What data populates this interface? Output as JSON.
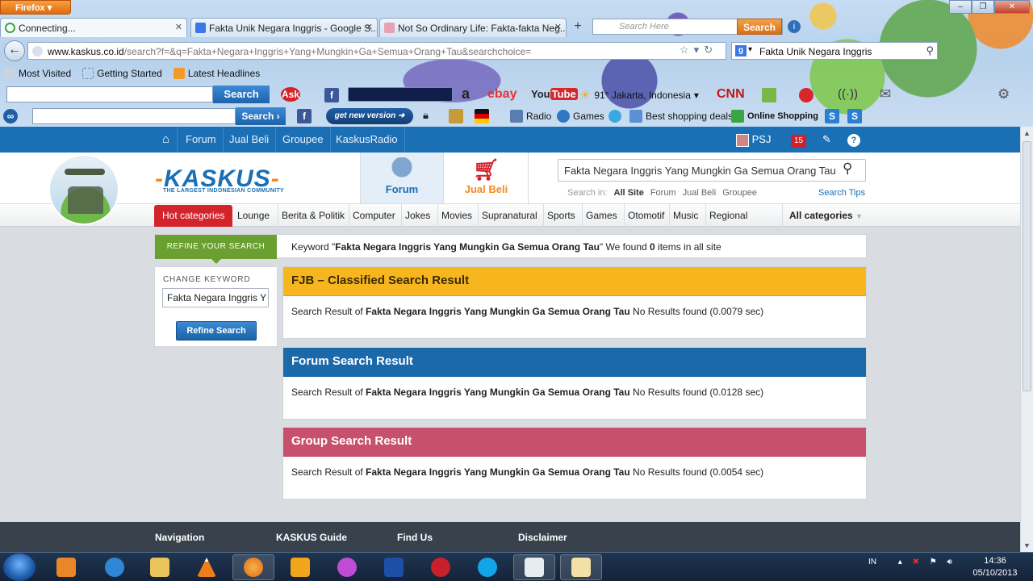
{
  "browser": {
    "firefox_button": "Firefox",
    "tabs": [
      {
        "title": "Connecting..."
      },
      {
        "title": "Fakta Unik Negara Inggris - Google S..."
      },
      {
        "title": "Not So Ordinary Life: Fakta-fakta Neg..."
      }
    ],
    "toolbar_search_placeholder": "Search Here",
    "toolbar_search_button": "Search",
    "url_domain": "www.kaskus.co.id",
    "url_rest": "/search?f=&q=Fakta+Negara+Inggris+Yang+Mungkin+Ga+Semua+Orang+Tau&searchchoice=",
    "web_search_value": "Fakta Unik Negara Inggris",
    "bookmarks": [
      {
        "label": "Most Visited"
      },
      {
        "label": "Getting Started"
      },
      {
        "label": "Latest Headlines"
      }
    ],
    "ask_search_button": "Search",
    "weather": "91° Jakarta, Indonesia",
    "toolbar2_search_button": "Search",
    "get_new_version": "get new version",
    "radio": "Radio",
    "games": "Games",
    "best_shopping": "Best shopping deals",
    "online_shopping": "Online Shopping"
  },
  "kaskus": {
    "topnav": [
      "Forum",
      "Jual Beli",
      "Groupee",
      "KaskusRadio"
    ],
    "user": "PSJ",
    "notif_count": "15",
    "logo_text": "KASKUS",
    "logo_tagline": "THE LARGEST INDONESIAN COMMUNITY",
    "forum_link": "Forum",
    "jualbeli_link": "Jual Beli",
    "search_value": "Fakta Negara Inggris Yang Mungkin Ga Semua Orang Tau",
    "search_in_label": "Search in:",
    "search_in": [
      "All Site",
      "Forum",
      "Jual Beli",
      "Groupee"
    ],
    "search_tips": "Search Tips",
    "hot_categories": "Hot categories",
    "categories": [
      "Lounge",
      "Berita & Politik",
      "Computer",
      "Jokes",
      "Movies",
      "Supranatural",
      "Sports",
      "Games",
      "Otomotif",
      "Music",
      "Regional"
    ],
    "all_categories": "All categories",
    "refine_label": "REFINE YOUR SEARCH",
    "keyword_prefix": "Keyword \"",
    "keyword": "Fakta Negara Inggris Yang Mungkin Ga Semua Orang Tau",
    "found_prefix": "\" We found ",
    "found_count": "0",
    "found_suffix": " items in all site",
    "change_keyword_label": "CHANGE KEYWORD",
    "change_keyword_value": "Fakta Negara Inggris Y",
    "refine_button": "Refine Search",
    "result_prefix": "Search Result of ",
    "results": [
      {
        "title": "FJB – Classified Search Result",
        "status": " No Results found (0.0079 sec)"
      },
      {
        "title": "Forum Search Result",
        "status": " No Results found (0.0128 sec)"
      },
      {
        "title": "Group Search Result",
        "status": " No Results found (0.0054 sec)"
      }
    ],
    "footer": [
      "Navigation",
      "KASKUS Guide",
      "Find Us",
      "Disclaimer"
    ]
  },
  "taskbar": {
    "lang": "IN",
    "time": "14:36",
    "date": "05/10/2013"
  },
  "colors": {
    "kaskus_blue": "#1a6fb5",
    "hot_red": "#d3242c",
    "refine_green": "#6aa030",
    "fjb_yellow": "#f7b61d",
    "forum_blue": "#1c69aa",
    "group_pink": "#c7506d"
  }
}
